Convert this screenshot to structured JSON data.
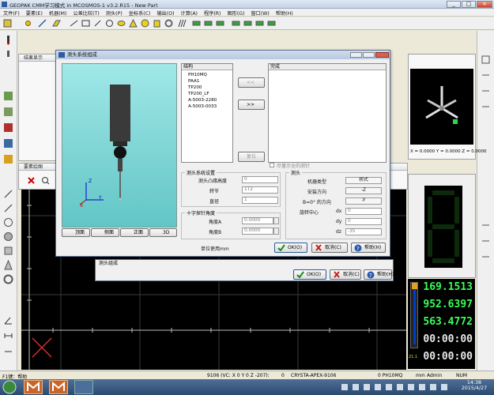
{
  "window": {
    "title": "GEOPAK CMM学习模式 in MCOSMOS-1 v3.2.R15   -  New Part",
    "min": "_",
    "max": "□",
    "close": "×"
  },
  "menu": [
    "文件(F)",
    "要素(E)",
    "机器(M)",
    "公差比较(T)",
    "测头(P)",
    "坐标系(C)",
    "输出(O)",
    "计算(A)",
    "程序(R)",
    "图形(G)",
    "窗口(W)",
    "帮助(H)"
  ],
  "panels": {
    "results": "结果显示",
    "graphics": "要素绘图"
  },
  "probe_dialog": {
    "title": "测头系统组成",
    "tree_title": "结构",
    "tree_items": [
      "PH10MQ",
      "PAA1",
      "TP200",
      "TP200_LF",
      "A-5003-2280",
      "A-5003-0033"
    ],
    "finish_title": "完成",
    "btn_left": "<<",
    "btn_right": ">>",
    "btn_reset": "复位",
    "show_all": "尽量示全的测针",
    "views": [
      "顶面",
      "侧面",
      "正面",
      "3D"
    ],
    "axis_z": "Z",
    "axis_y": "Y",
    "axis_x": "X",
    "probe_settings": {
      "title": "测头系统设置",
      "rows": [
        {
          "label": "测头凸缘高度",
          "value": "0"
        },
        {
          "label": "转节",
          "value": "1T2"
        },
        {
          "label": "直径",
          "value": "1"
        }
      ]
    },
    "cross_probe": {
      "title": "十字探针角度",
      "rows": [
        {
          "label": "角度A",
          "value": "0.0000"
        },
        {
          "label": "角度B",
          "value": "0.0000"
        }
      ]
    },
    "head": {
      "title": "测头",
      "rows": [
        {
          "label": "机器类型",
          "value": "桥式"
        },
        {
          "label": "安装方向",
          "value": "-Z"
        },
        {
          "label": "B=0° 的方向",
          "value": "-Y"
        }
      ],
      "rot_center": "旋转中心",
      "dx_label": "dx",
      "dx": "0",
      "dy_label": "dy",
      "dy": "0",
      "dz_label": "dz",
      "dz": "-35"
    },
    "unit": "单位使用mm",
    "ok": "OK(O)",
    "cancel": "取消(C)",
    "help": "帮助(H)"
  },
  "back_dialog": {
    "title": "测头组成",
    "ok": "OK(O)",
    "cancel": "取消(C)",
    "help": "帮助(H)"
  },
  "coord_readout": "X = 0.0000 Y = 0.0000 Z = 0.0000",
  "dro": {
    "values": [
      "169.1513",
      "952.6397",
      "563.4772",
      "00:00:00",
      "00:00:00"
    ],
    "temp": "21.1",
    "accent": "#39ff5a"
  },
  "status": {
    "help": "F1键：帮助",
    "coords": "9106 (VC: X 0 Y 0 Z -207):",
    "count": "0",
    "machine": "CRYSTA-APEX-9106",
    "probe": "0  PH10MQ",
    "unit": "mm",
    "user": "Admin",
    "num": "NUM"
  },
  "taskbar": {
    "time": "14:38",
    "date": "2015/4/27"
  }
}
